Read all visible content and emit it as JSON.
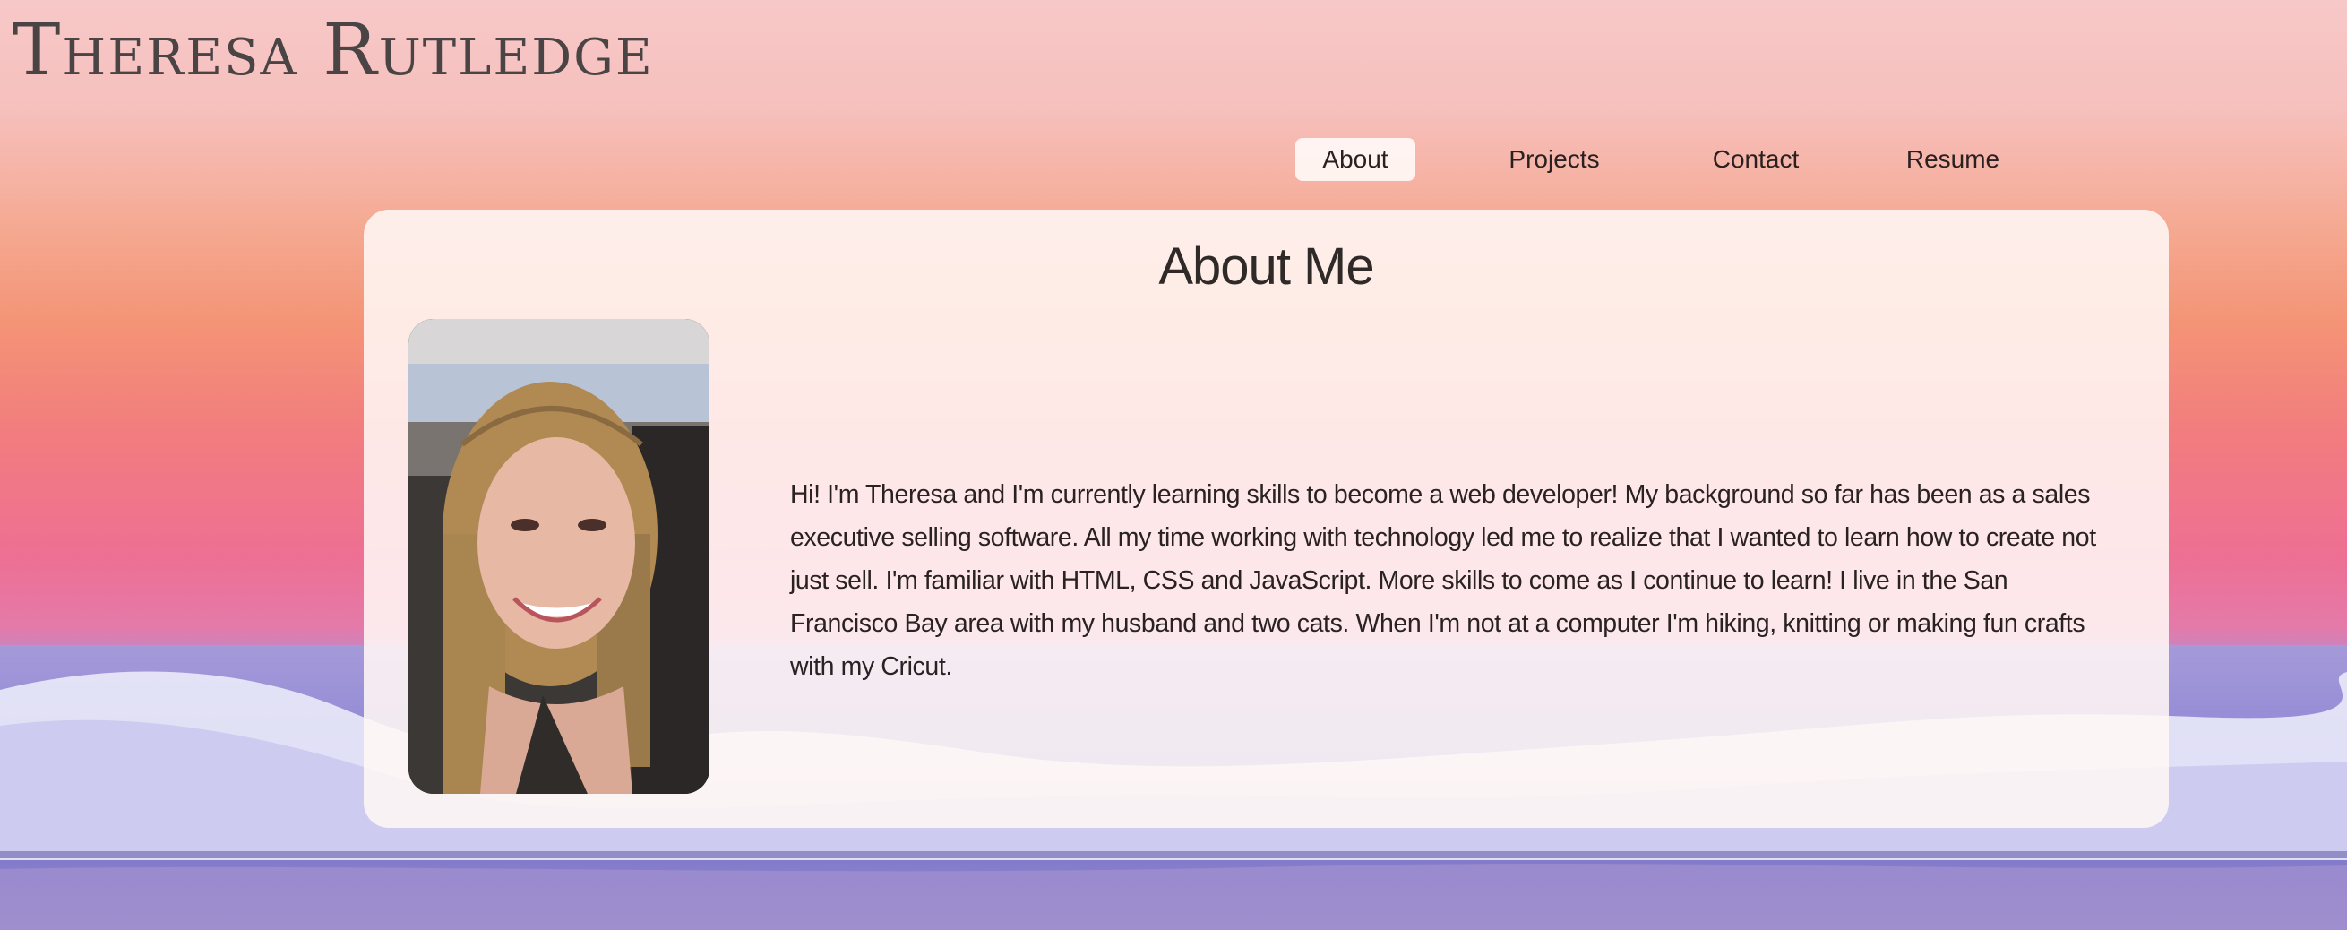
{
  "site": {
    "title": "Theresa Rutledge"
  },
  "nav": {
    "items": [
      {
        "label": "About",
        "active": true
      },
      {
        "label": "Projects",
        "active": false
      },
      {
        "label": "Contact",
        "active": false
      },
      {
        "label": "Resume",
        "active": false
      }
    ]
  },
  "about": {
    "heading": "About Me",
    "bio": "Hi! I'm Theresa and I'm currently learning skills to become a web developer! My background so far has been as a sales executive selling software. All my time working with technology led me to realize that I wanted to learn how to create not just sell. I'm familiar with HTML, CSS and JavaScript. More skills to come as I continue to learn! I live in the San Francisco Bay area with my husband and two cats. When I'm not at a computer I'm hiking, knitting or making fun crafts with my Cricut."
  },
  "colors": {
    "nav_active_bg": "#fff8f6",
    "card_bg": "#fff7f5",
    "text": "#2a2222"
  }
}
